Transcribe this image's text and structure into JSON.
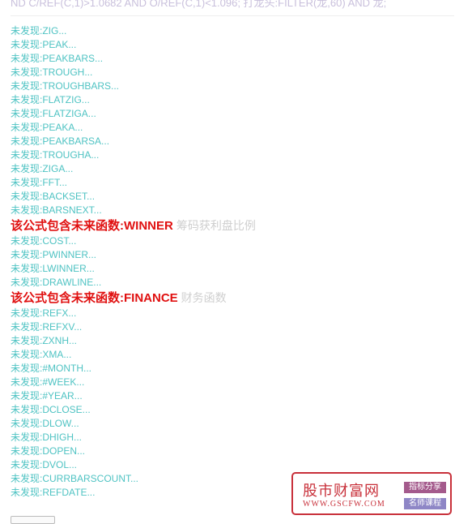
{
  "header": {
    "formula_text": "ND C/REF(C,1)>1.0682 AND O/REF(C,1)<1.096; 打龙头:FILTER(龙,60) AND 龙;"
  },
  "check_results": [
    {
      "type": "missing",
      "text": "未发现:ZIG..."
    },
    {
      "type": "missing",
      "text": "未发现:PEAK..."
    },
    {
      "type": "missing",
      "text": "未发现:PEAKBARS..."
    },
    {
      "type": "missing",
      "text": "未发现:TROUGH..."
    },
    {
      "type": "missing",
      "text": "未发现:TROUGHBARS..."
    },
    {
      "type": "missing",
      "text": "未发现:FLATZIG..."
    },
    {
      "type": "missing",
      "text": "未发现:FLATZIGA..."
    },
    {
      "type": "missing",
      "text": "未发现:PEAKA..."
    },
    {
      "type": "missing",
      "text": "未发现:PEAKBARSA..."
    },
    {
      "type": "missing",
      "text": "未发现:TROUGHA..."
    },
    {
      "type": "missing",
      "text": "未发现:ZIGA..."
    },
    {
      "type": "missing",
      "text": "未发现:FFT..."
    },
    {
      "type": "missing",
      "text": "未发现:BACKSET..."
    },
    {
      "type": "missing",
      "text": "未发现:BARSNEXT..."
    },
    {
      "type": "warning",
      "text": "该公式包含未来函数:WINNER",
      "desc": "筹码获利盘比例"
    },
    {
      "type": "missing",
      "text": "未发现:COST..."
    },
    {
      "type": "missing",
      "text": "未发现:PWINNER..."
    },
    {
      "type": "missing",
      "text": "未发现:LWINNER..."
    },
    {
      "type": "missing",
      "text": "未发现:DRAWLINE..."
    },
    {
      "type": "warning",
      "text": "该公式包含未来函数:FINANCE",
      "desc": "财务函数"
    },
    {
      "type": "missing",
      "text": "未发现:REFX..."
    },
    {
      "type": "missing",
      "text": "未发现:REFXV..."
    },
    {
      "type": "missing",
      "text": "未发现:ZXNH..."
    },
    {
      "type": "missing",
      "text": "未发现:XMA..."
    },
    {
      "type": "missing",
      "text": "未发现:#MONTH..."
    },
    {
      "type": "missing",
      "text": "未发现:#WEEK..."
    },
    {
      "type": "missing",
      "text": "未发现:#YEAR..."
    },
    {
      "type": "missing",
      "text": "未发现:DCLOSE..."
    },
    {
      "type": "missing",
      "text": "未发现:DLOW..."
    },
    {
      "type": "missing",
      "text": "未发现:DHIGH..."
    },
    {
      "type": "missing",
      "text": "未发现:DOPEN..."
    },
    {
      "type": "missing",
      "text": "未发现:DVOL..."
    },
    {
      "type": "missing",
      "text": "未发现:CURRBARSCOUNT..."
    },
    {
      "type": "missing",
      "text": "未发现:REFDATE..."
    }
  ],
  "watermark": {
    "site_name": "股市财富网",
    "url": "WWW.GSCFW.COM",
    "tag1": "指标分享",
    "tag2": "名师课程"
  },
  "colors": {
    "missing_text": "#4fc3c3",
    "warning_text": "#e01010",
    "description_text": "#cfcfcf",
    "watermark_red": "#c8303a"
  }
}
